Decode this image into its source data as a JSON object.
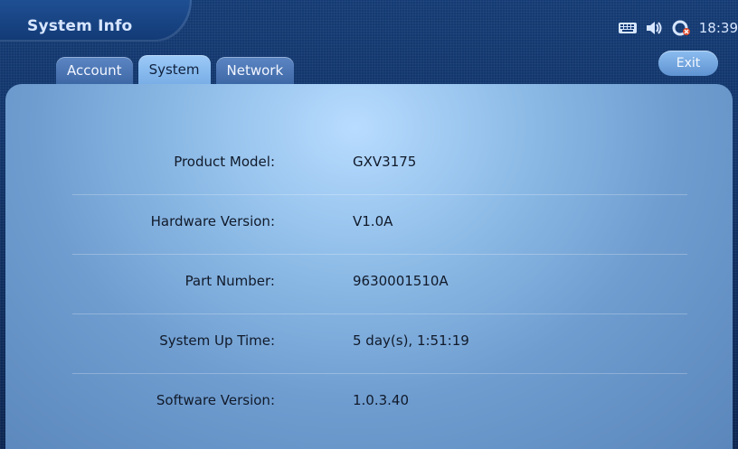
{
  "header": {
    "title": "System Info",
    "status": {
      "time": "18:39",
      "icons": [
        "keyboard-icon",
        "speaker-icon",
        "connection-error-icon"
      ]
    }
  },
  "tabs": [
    {
      "label": "Account",
      "active": false
    },
    {
      "label": "System",
      "active": true
    },
    {
      "label": "Network",
      "active": false
    }
  ],
  "exit_label": "Exit",
  "info": [
    {
      "label": "Product Model:",
      "value": "GXV3175"
    },
    {
      "label": "Hardware Version:",
      "value": "V1.0A"
    },
    {
      "label": "Part Number:",
      "value": "9630001510A"
    },
    {
      "label": "System Up Time:",
      "value": "5 day(s), 1:51:19"
    },
    {
      "label": "Software Version:",
      "value": "1.0.3.40"
    }
  ]
}
